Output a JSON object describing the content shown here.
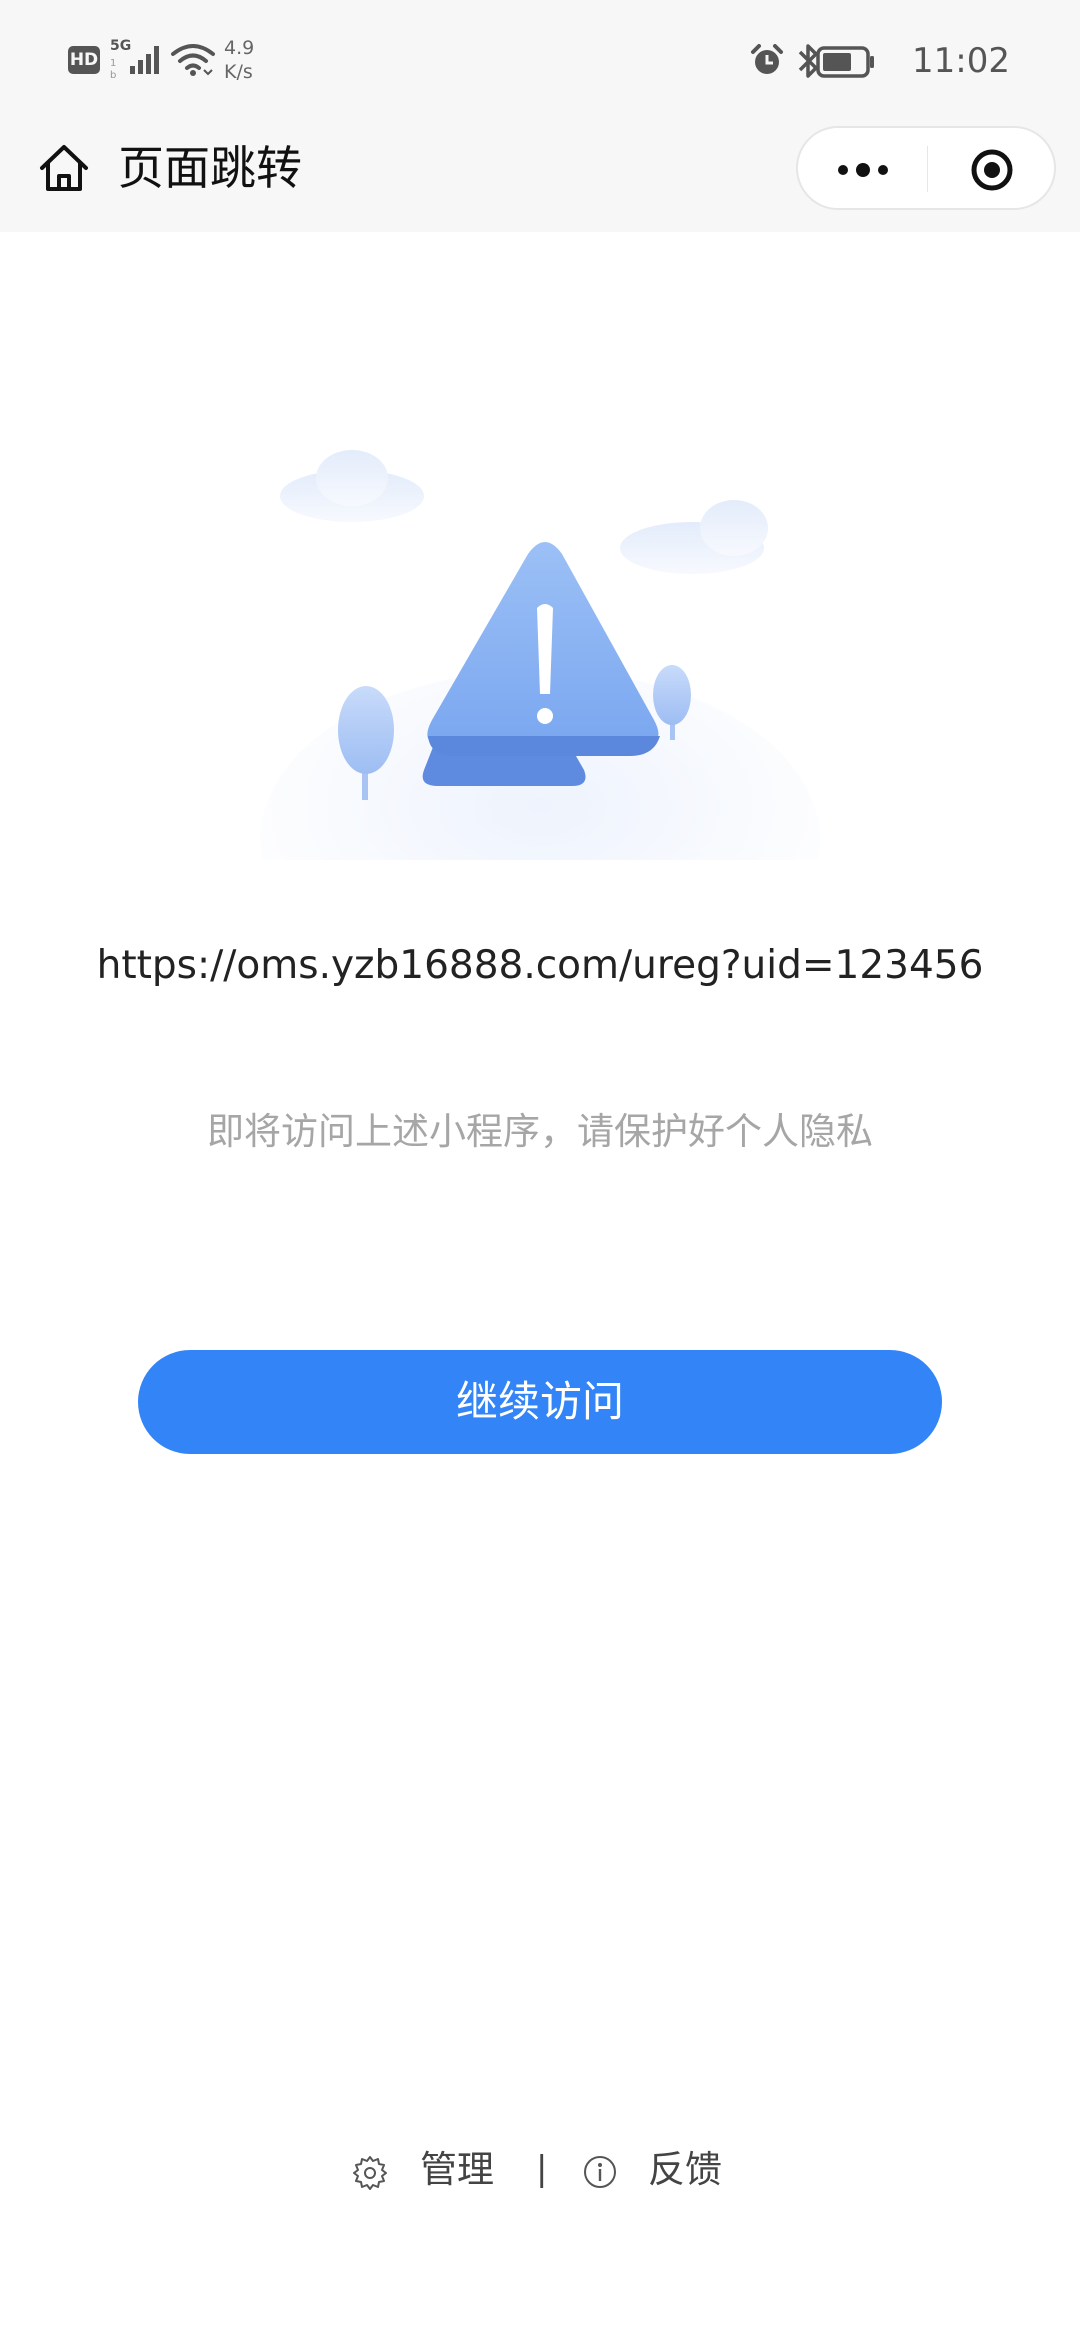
{
  "status_bar": {
    "hd_badge": "HD",
    "network_type": "5G",
    "network_sub": "1 b",
    "speed_value": "4.9",
    "speed_unit": "K/s",
    "time": "11:02",
    "icons": [
      "signal-icon",
      "wifi-icon",
      "alarm-icon",
      "bluetooth-icon",
      "battery-icon"
    ]
  },
  "nav": {
    "title": "页面跳转",
    "icons": [
      "home-icon",
      "more-icon",
      "target-icon"
    ]
  },
  "content": {
    "url": "https://oms.yzb16888.com/ureg?uid=123456",
    "hint": "即将访问上述小程序，请保护好个人隐私",
    "continue_label": "继续访问",
    "illustration_icon": "warning-icon"
  },
  "footer": {
    "manage_label": "管理",
    "separator": "|",
    "feedback_label": "反馈",
    "icons": [
      "gear-icon",
      "info-icon"
    ]
  },
  "colors": {
    "accent": "#3385f7",
    "bar_background": "#f7f7f7",
    "hint_text": "#a6a6a6",
    "warning_blue": "#7aa7f0"
  }
}
